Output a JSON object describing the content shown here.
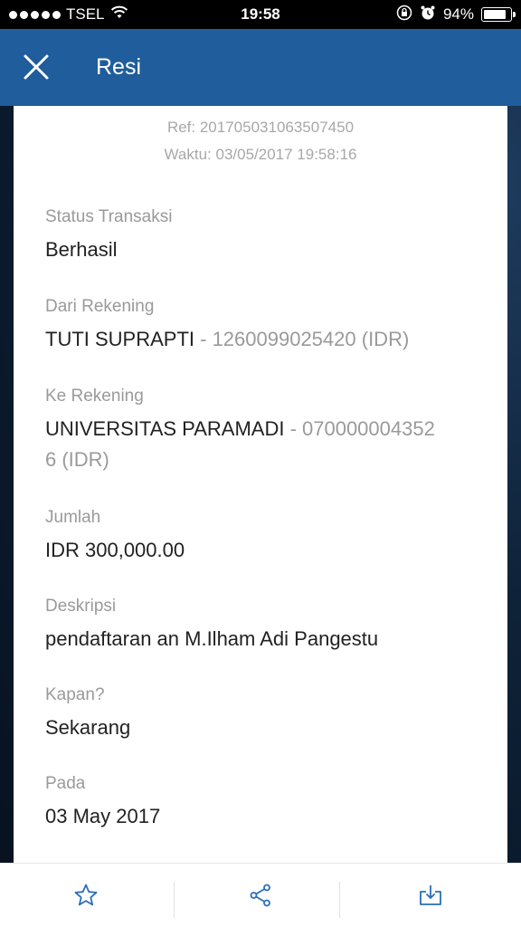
{
  "status_bar": {
    "carrier": "TSEL",
    "time": "19:58",
    "battery": "94%",
    "battery_level": 0.94,
    "signal_bars": 5
  },
  "header": {
    "title": "Resi",
    "close_icon": "close-icon"
  },
  "receipt": {
    "ref": "Ref: 201705031063507450",
    "time": "Waktu: 03/05/2017 19:58:16",
    "status": {
      "label": "Status Transaksi",
      "value": "Berhasil"
    },
    "from_account": {
      "label": "Dari Rekening",
      "name": "TUTI SUPRAPTI",
      "detail": " - 1260099025420 (IDR)"
    },
    "to_account": {
      "label": "Ke Rekening",
      "name": "UNIVERSITAS PARAMADI",
      "detail_line1": " - 070000004352",
      "detail_line2": "6 (IDR)"
    },
    "amount": {
      "label": "Jumlah",
      "value": "IDR 300,000.00"
    },
    "description": {
      "label": "Deskripsi",
      "value": "pendaftaran an M.Ilham Adi Pangestu"
    },
    "when": {
      "label": "Kapan?",
      "value": "Sekarang"
    },
    "date": {
      "label": "Pada",
      "value": "03 May 2017"
    }
  },
  "bottom_bar": {
    "icons": [
      "star-icon",
      "share-icon",
      "download-icon"
    ],
    "accent": "#2a6fb7"
  },
  "colors": {
    "header_bg": "#1f5d9c",
    "card_bg": "#ffffff"
  }
}
